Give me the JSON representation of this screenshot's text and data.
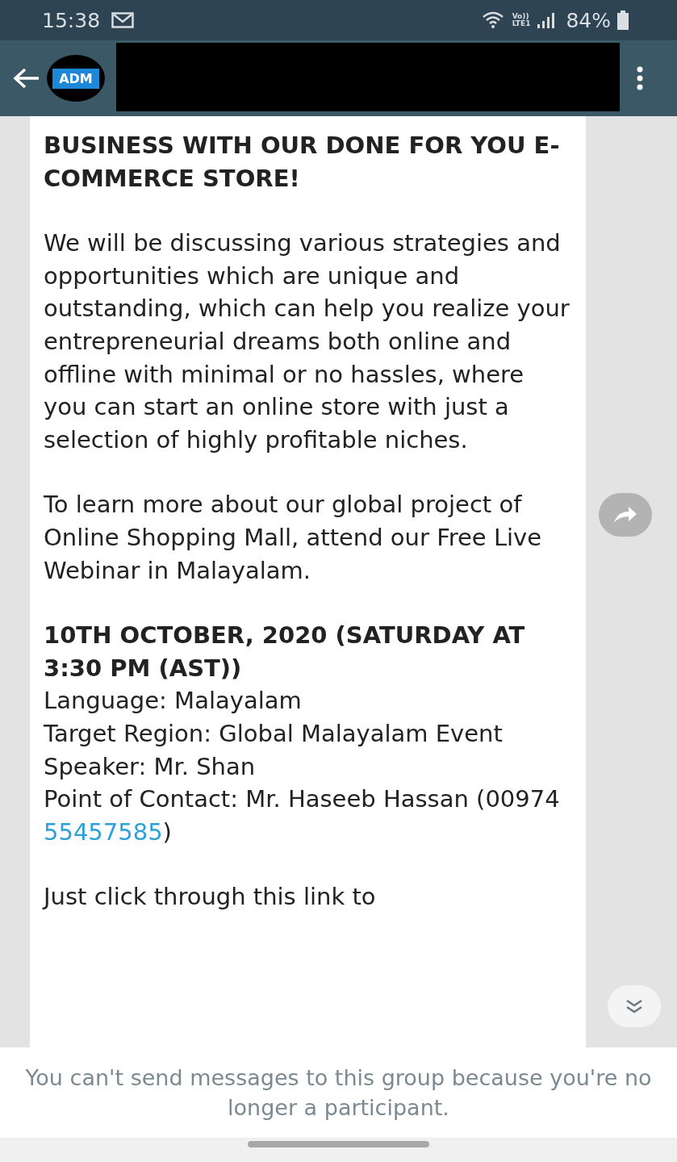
{
  "status_bar": {
    "time": "15:38",
    "network": "Vo))\nLTE1",
    "battery": "84%"
  },
  "header": {
    "logo_text": "ADM"
  },
  "message": {
    "heading": "BUSINESS WITH OUR DONE FOR YOU E-COMMERCE STORE!",
    "paragraphs": [
      "We will be discussing various strategies and opportunities which are unique and outstanding, which can help you realize your entrepreneurial dreams both online and offline with minimal or no hassles, where you can start an online store with just a selection of highly profitable niches.",
      "To learn more about our global project of Online Shopping Mall, attend our Free Live Webinar in Malayalam."
    ],
    "event_heading": "10TH OCTOBER, 2020 (SATURDAY AT 3:30 PM (AST))",
    "details": [
      "Language: Malayalam",
      "Target Region: Global Malayalam Event",
      "Speaker: Mr. Shan"
    ],
    "contact": {
      "prefix": "Point of Contact: Mr. Haseeb Hassan (00974 ",
      "link": "55457585",
      "suffix": ")"
    },
    "closing": "Just click through this link to"
  },
  "notice": "You can't send messages to this group because you're no longer a participant."
}
